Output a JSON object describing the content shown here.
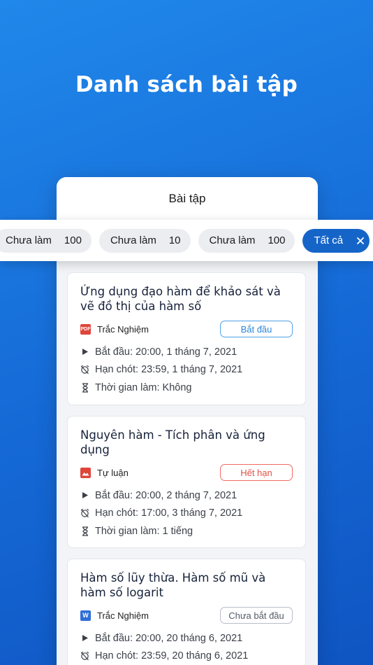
{
  "hero": {
    "title": "Danh sách bài tập"
  },
  "header": {
    "title": "Bài tập"
  },
  "filters": [
    {
      "label": "Chưa làm",
      "count": "100"
    },
    {
      "label": "Chưa làm",
      "count": "10"
    },
    {
      "label": "Chưa làm",
      "count": "100"
    },
    {
      "label": "Tất cả",
      "count": ""
    }
  ],
  "assignments": [
    {
      "title": "Ứng dụng đạo hàm để khảo sát và vẽ đồ thị của hàm số",
      "type": "Trắc Nghiệm",
      "type_icon": "pdf-icon",
      "status": "Bắt đầu",
      "start": "Bắt đầu: 20:00, 1 tháng 7, 2021",
      "deadline": "Hạn chót: 23:59, 1 tháng 7, 2021",
      "duration": "Thời gian làm: Không"
    },
    {
      "title": "Nguyên hàm - Tích phân và ứng dụng",
      "type": "Tự luận",
      "type_icon": "image-icon",
      "status": "Hết hạn",
      "start": "Bắt đầu: 20:00, 2 tháng 7, 2021",
      "deadline": "Hạn chót: 17:00, 3 tháng 7, 2021",
      "duration": "Thời gian làm: 1 tiếng"
    },
    {
      "title": "Hàm số lũy thừa. Hàm số mũ và hàm số logarit",
      "type": "Trắc Nghiệm",
      "type_icon": "word-icon",
      "status": "Chưa bắt đầu",
      "start": "Bắt đầu: 20:00, 20 tháng 6, 2021",
      "deadline": "Hạn chót: 23:59, 20 tháng 6, 2021"
    }
  ],
  "colors": {
    "accent": "#1565c9",
    "background_gradient_top": "#2088ea",
    "status_start": "#2a86db",
    "status_expired": "#e05247",
    "status_not_started": "#555c66"
  }
}
